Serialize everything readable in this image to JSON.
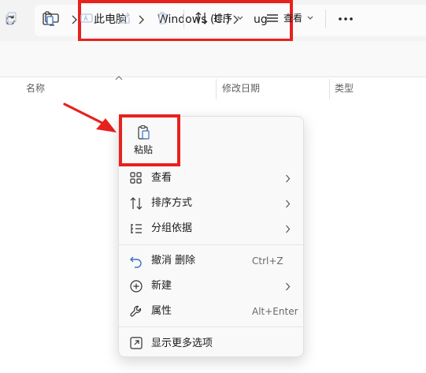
{
  "breadcrumb": {
    "items": [
      "此电脑",
      "Windows (C:)",
      "ug"
    ]
  },
  "toolbar": {
    "sort_label": "排序",
    "view_label": "查看"
  },
  "columns": {
    "name": "名称",
    "modified": "修改日期",
    "type": "类型"
  },
  "context_menu": {
    "paste_label": "粘贴",
    "items": [
      {
        "label": "查看",
        "icon": "grid-view-icon",
        "submenu": true
      },
      {
        "label": "排序方式",
        "icon": "sort-icon",
        "submenu": true
      },
      {
        "label": "分组依据",
        "icon": "group-by-icon",
        "submenu": true
      },
      {
        "label": "撤消 删除",
        "icon": "undo-icon",
        "shortcut": "Ctrl+Z"
      },
      {
        "label": "新建",
        "icon": "new-plus-icon",
        "submenu": true
      },
      {
        "label": "属性",
        "icon": "wrench-icon",
        "shortcut": "Alt+Enter"
      },
      {
        "label": "显示更多选项",
        "icon": "more-options-icon"
      }
    ]
  },
  "colors": {
    "highlight_border": "#e8211d",
    "arrow": "#e8211d",
    "menu_bg": "#f9f9f9"
  }
}
